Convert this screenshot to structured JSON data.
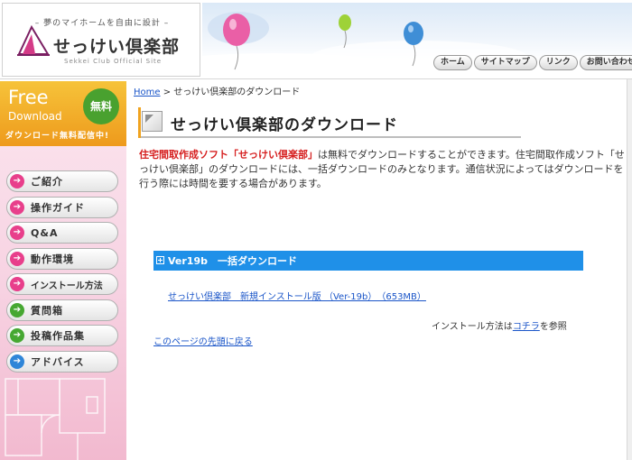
{
  "header": {
    "catch_copy": "– 夢のマイホームを自由に設計 –",
    "site_title": "せっけい倶楽部",
    "site_subtitle": "Sekkei Club Official Site",
    "nav": [
      "ホーム",
      "サイトマップ",
      "リンク",
      "お問い合わせ"
    ]
  },
  "sidebar": {
    "banner": {
      "title": "Free",
      "subtitle": "Download",
      "badge": "無料",
      "note": "ダウンロード無料配信中!"
    },
    "menu": [
      {
        "label": "ご紹介",
        "color": "#e83f8b"
      },
      {
        "label": "操作ガイド",
        "color": "#e83f8b"
      },
      {
        "label": "Q&A",
        "color": "#e83f8b"
      },
      {
        "label": "動作環境",
        "color": "#e83f8b"
      },
      {
        "label": "インストール方法",
        "color": "#e83f8b"
      },
      {
        "label": "質問箱",
        "color": "#46a832"
      },
      {
        "label": "投稿作品集",
        "color": "#46a832"
      },
      {
        "label": "アドバイス",
        "color": "#2f86d8"
      }
    ]
  },
  "breadcrumb": {
    "home": "Home",
    "separator": " > ",
    "current": "せっけい倶楽部のダウンロード"
  },
  "main": {
    "title": "せっけい倶楽部のダウンロード",
    "intro_highlight": "住宅間取作成ソフト「せっけい倶楽部」",
    "intro_text": "は無料でダウンロードすることができます。住宅間取作成ソフト「せっけい倶楽部」のダウンロードには、一括ダウンロードのみとなります。通信状況によってはダウンロードを行う際には時間を要する場合があります。",
    "version_heading": "Ver19b　一括ダウンロード",
    "download_link": "せっけい倶楽部　新規インストール版 （Ver-19b）　（653MB）",
    "install_note_prefix": "インストール方法は",
    "install_note_link": "コチラ",
    "install_note_suffix": "を参照",
    "page_top_link": "このページの先頭に戻る"
  },
  "colors": {
    "accent_blue": "#1f90e8",
    "highlight_red": "#d62020",
    "banner_orange": "#ee9a1c"
  },
  "icons": {
    "menu_arrow": "right-arrow-circle-icon",
    "version_toggle": "plus-box-icon",
    "title_marker": "corner-square-icon"
  }
}
